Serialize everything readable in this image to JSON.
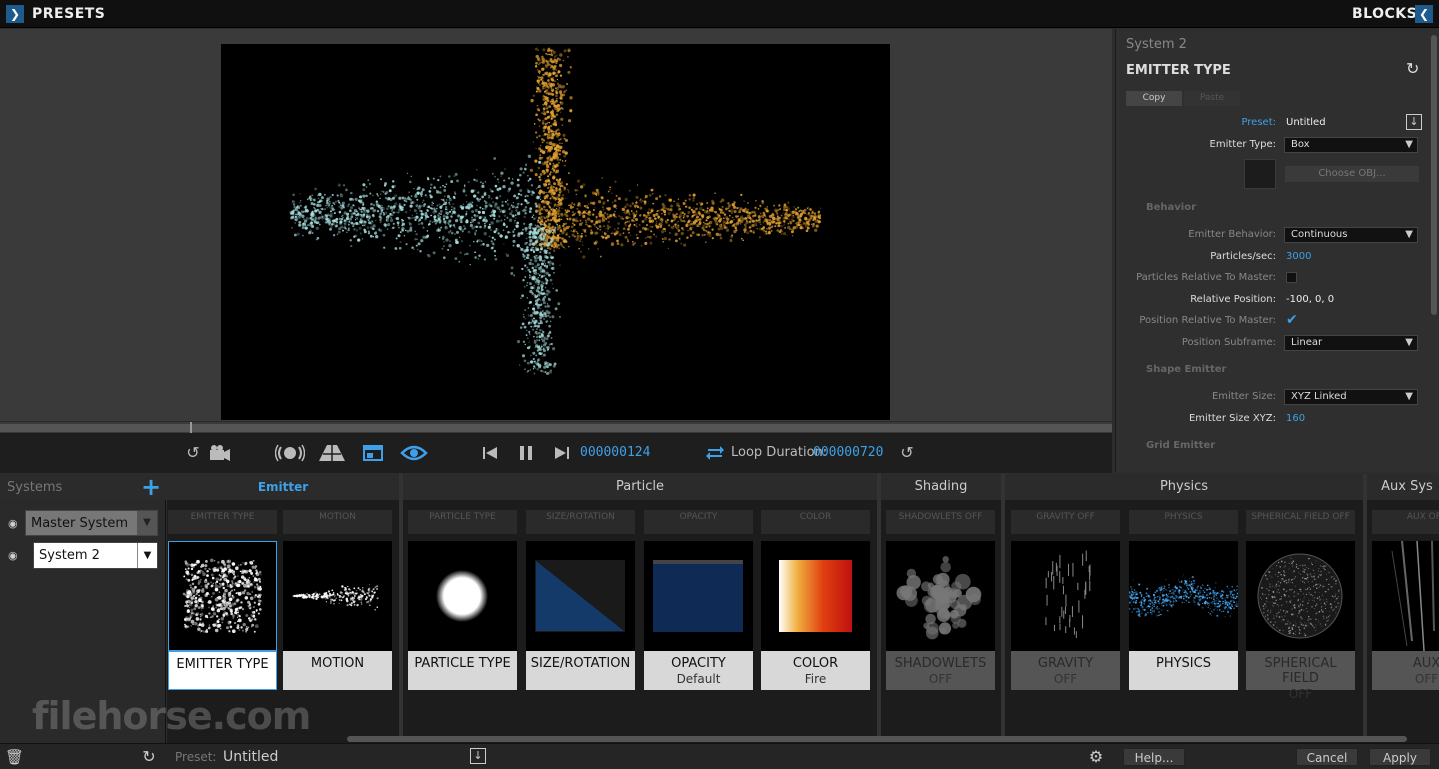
{
  "topbar": {
    "left_title": "PRESETS",
    "right_title": "BLOCKS"
  },
  "transport": {
    "frame": "000000124",
    "loop_label": "Loop Duration:",
    "loop_value": "000000720"
  },
  "panel": {
    "system_name": "System 2",
    "title": "EMITTER TYPE",
    "copy_label": "Copy",
    "paste_label": "Paste",
    "preset_label": "Preset:",
    "preset_value": "Untitled",
    "emitter_type_label": "Emitter Type:",
    "emitter_type_value": "Box",
    "choose_obj_label": "Choose OBJ...",
    "behavior_section": "Behavior",
    "emitter_behavior_label": "Emitter Behavior:",
    "emitter_behavior_value": "Continuous",
    "particles_sec_label": "Particles/sec:",
    "particles_sec_value": "3000",
    "particles_relative_label": "Particles Relative To Master:",
    "relative_position_label": "Relative Position:",
    "relative_position_value": "-100, 0, 0",
    "position_relative_label": "Position Relative To Master:",
    "position_subframe_label": "Position Subframe:",
    "position_subframe_value": "Linear",
    "shape_section": "Shape Emitter",
    "emitter_size_label": "Emitter Size:",
    "emitter_size_value": "XYZ Linked",
    "emitter_size_xyz_label": "Emitter Size XYZ:",
    "emitter_size_xyz_value": "160",
    "grid_section": "Grid Emitter"
  },
  "systems": {
    "header": "Systems",
    "items": [
      {
        "label": "Master System"
      },
      {
        "label": "System 2"
      }
    ]
  },
  "blocks": {
    "categories": [
      "Emitter",
      "Particle",
      "Shading",
      "Physics",
      "Aux Sys"
    ],
    "items": [
      {
        "header": "EMITTER TYPE",
        "label": "EMITTER TYPE",
        "sub": ""
      },
      {
        "header": "MOTION",
        "label": "MOTION",
        "sub": ""
      },
      {
        "header": "PARTICLE TYPE",
        "label": "PARTICLE TYPE",
        "sub": ""
      },
      {
        "header": "SIZE/ROTATION",
        "label": "SIZE/ROTATION",
        "sub": ""
      },
      {
        "header": "OPACITY",
        "label": "OPACITY",
        "sub": "Default"
      },
      {
        "header": "COLOR",
        "label": "COLOR",
        "sub": "Fire"
      },
      {
        "header": "SHADOWLETS OFF",
        "label": "SHADOWLETS",
        "sub": "OFF"
      },
      {
        "header": "GRAVITY OFF",
        "label": "GRAVITY",
        "sub": "OFF"
      },
      {
        "header": "PHYSICS",
        "label": "PHYSICS",
        "sub": ""
      },
      {
        "header": "SPHERICAL FIELD OFF",
        "label": "SPHERICAL FIELD",
        "sub": "OFF"
      },
      {
        "header": "AUX OFF",
        "label": "AUX",
        "sub": "OFF"
      }
    ]
  },
  "bottombar": {
    "preset_label": "Preset:",
    "preset_value": "Untitled",
    "help_label": "Help...",
    "cancel_label": "Cancel",
    "apply_label": "Apply"
  },
  "watermark": "filehorse.com",
  "colors": {
    "accent": "#3ea0e8",
    "orange": "#e0a030",
    "cyan": "#a8e0e0"
  }
}
